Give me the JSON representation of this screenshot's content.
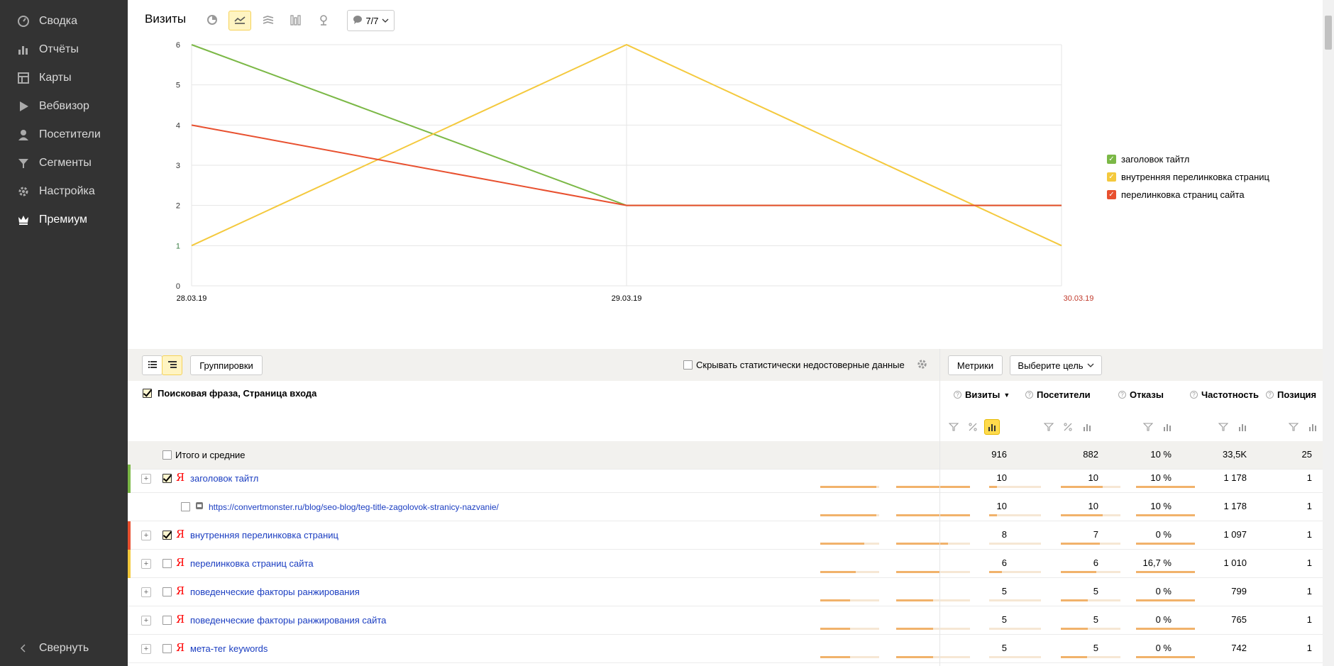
{
  "sidebar": {
    "items": [
      {
        "label": "Сводка",
        "icon": "gauge-icon"
      },
      {
        "label": "Отчёты",
        "icon": "bar-chart-icon"
      },
      {
        "label": "Карты",
        "icon": "map-icon"
      },
      {
        "label": "Вебвизор",
        "icon": "play-icon"
      },
      {
        "label": "Посетители",
        "icon": "user-icon"
      },
      {
        "label": "Сегменты",
        "icon": "funnel-icon"
      },
      {
        "label": "Настройка",
        "icon": "gear-icon"
      },
      {
        "label": "Премиум",
        "icon": "crown-icon"
      }
    ],
    "collapse_label": "Свернуть"
  },
  "chart_toolbar": {
    "title": "Визиты",
    "annotations_label": "7/7"
  },
  "chart_data": {
    "type": "line",
    "x": [
      "28.03.19",
      "29.03.19",
      "30.03.19"
    ],
    "yticks": [
      "0",
      "1",
      "2",
      "3",
      "4",
      "5",
      "6"
    ],
    "ylim": [
      0,
      6
    ],
    "grid": true,
    "legend_position": "right",
    "series": [
      {
        "name": "заголовок тайтл",
        "color": "#7bb846",
        "values": [
          6,
          2,
          2
        ]
      },
      {
        "name": "внутренняя перелинковка страниц",
        "color": "#f4c93d",
        "values": [
          1,
          6,
          1
        ]
      },
      {
        "name": "перелинковка страниц сайта",
        "color": "#e8502f",
        "values": [
          4,
          2,
          2
        ]
      }
    ]
  },
  "table_toolbar": {
    "groupings_label": "Группировки",
    "hide_unreliable_label": "Скрывать статистически недостоверные данные",
    "metrics_label": "Метрики",
    "goal_label": "Выберите цель"
  },
  "table": {
    "dimension_header": "Поисковая фраза, Страница входа",
    "columns": [
      {
        "label": "Визиты",
        "sort": "▼"
      },
      {
        "label": "Посетители"
      },
      {
        "label": "Отказы"
      },
      {
        "label": "Частотность"
      },
      {
        "label": "Позиция"
      }
    ],
    "total": {
      "label": "Итого и средние",
      "values": [
        "916",
        "882",
        "10 %",
        "33,5K",
        "25"
      ]
    },
    "rows": [
      {
        "label": "заголовок тайтл",
        "checked": true,
        "stripe": "#7bb846",
        "values": [
          "10",
          "10",
          "10 %",
          "1 178",
          "1"
        ],
        "bars": [
          0.95,
          1.0,
          0.15,
          0.7,
          1.0
        ]
      },
      {
        "label": "https://convertmonster.ru/blog/seo-blog/teg-title-zagolovok-stranicy-nazvanie/",
        "checked": false,
        "child": true,
        "values": [
          "10",
          "10",
          "10 %",
          "1 178",
          "1"
        ],
        "bars": [
          0.95,
          1.0,
          0.15,
          0.7,
          1.0
        ]
      },
      {
        "label": "внутренняя перелинковка страниц",
        "checked": true,
        "stripe": "#e8502f",
        "values": [
          "8",
          "7",
          "0 %",
          "1 097",
          "1"
        ],
        "bars": [
          0.75,
          0.7,
          0.0,
          0.65,
          1.0
        ]
      },
      {
        "label": "перелинковка страниц сайта",
        "checked": false,
        "stripe": "#f4c93d",
        "values": [
          "6",
          "6",
          "16,7 %",
          "1 010",
          "1"
        ],
        "bars": [
          0.6,
          0.6,
          0.25,
          0.6,
          1.0
        ]
      },
      {
        "label": "поведенческие факторы ранжирования",
        "checked": false,
        "values": [
          "5",
          "5",
          "0 %",
          "799",
          "1"
        ],
        "bars": [
          0.5,
          0.5,
          0.0,
          0.45,
          1.0
        ]
      },
      {
        "label": "поведенческие факторы ранжирования сайта",
        "checked": false,
        "values": [
          "5",
          "5",
          "0 %",
          "765",
          "1"
        ],
        "bars": [
          0.5,
          0.5,
          0.0,
          0.45,
          1.0
        ]
      },
      {
        "label": "мета-тег keywords",
        "checked": false,
        "values": [
          "5",
          "5",
          "0 %",
          "742",
          "1"
        ],
        "bars": [
          0.5,
          0.5,
          0.0,
          0.44,
          1.0
        ]
      }
    ]
  }
}
